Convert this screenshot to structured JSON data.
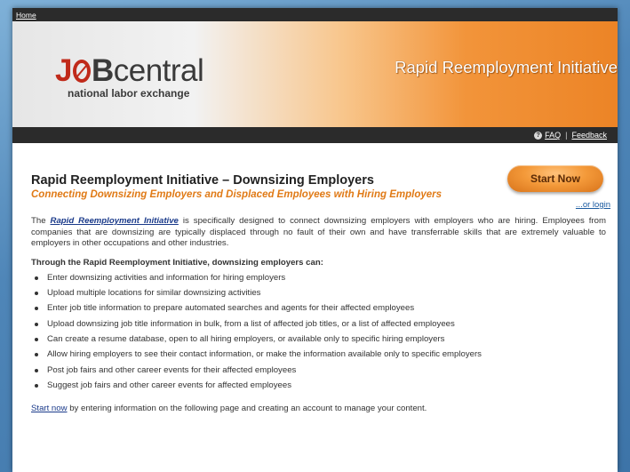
{
  "nav": {
    "home_link": "Home"
  },
  "logo": {
    "letter_j": "J",
    "letter_b": "B",
    "rest": "central",
    "tagline": "national labor exchange"
  },
  "header": {
    "title": "Rapid Reemployment Initiative"
  },
  "util": {
    "help_icon_glyph": "?",
    "faq_link": "FAQ",
    "separator": "|",
    "feedback_link": "Feedback"
  },
  "main": {
    "title": "Rapid Reemployment Initiative – Downsizing Employers",
    "subtitle": "Connecting Downsizing Employers and Displaced Employees with Hiring Employers",
    "start_button": "Start Now",
    "or_login": "...or login",
    "intro_prefix": "The ",
    "intro_link": "Rapid Reemployment Initiative",
    "intro_rest": " is specifically designed to connect downsizing employers with employers who are hiring. Employees from companies that are downsizing are typically displaced through no fault of their own and have transferrable skills that are extremely valuable to employers in other occupations and other industries.",
    "lead": "Through the Rapid Reemployment Initiative, downsizing employers can:",
    "items": [
      "Enter downsizing activities and information for hiring employers",
      "Upload multiple locations for similar downsizing activities",
      "Enter job title information to prepare automated searches and agents for their affected employees",
      "Upload downsizing job title information in bulk, from a list of affected job titles, or a list of affected employees",
      "Can create a resume database, open to all hiring employers, or available only to specific hiring employers",
      "Allow hiring employers to see their contact information, or make the information available only to specific employers",
      "Post job fairs and other career events for their affected employees",
      "Suggest job fairs and other career events for affected employees"
    ],
    "footer_link": "Start now",
    "footer_text": " by entering information on the following page and creating an account to manage your content."
  },
  "colors": {
    "accent_orange": "#e07a16",
    "logo_red": "#c02a1a",
    "bar_dark": "#2b2b2b",
    "link_blue": "#1a3a8a"
  }
}
